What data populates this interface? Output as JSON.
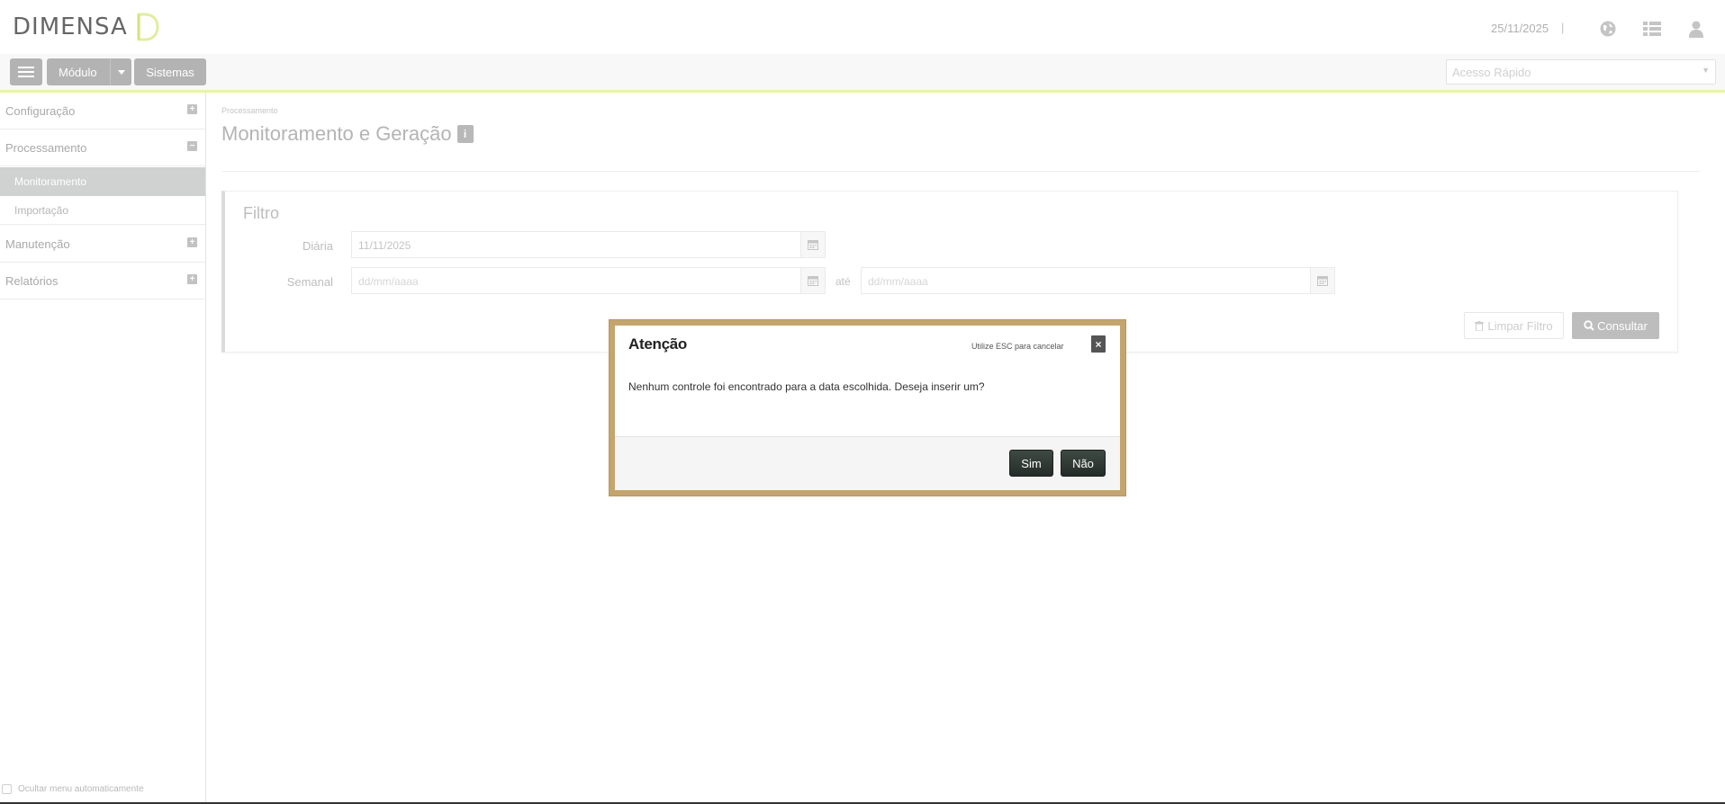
{
  "header": {
    "logo_text": "DIMENSA",
    "date": "25/11/2025",
    "separator": "|"
  },
  "toolbar": {
    "modulo_label": "Módulo",
    "sistemas_label": "Sistemas",
    "quick_access_placeholder": "Acesso Rápido"
  },
  "sidebar": {
    "items": [
      {
        "label": "Configuração",
        "toggle": "+"
      },
      {
        "label": "Processamento",
        "toggle": "−"
      },
      {
        "label": "Manutenção",
        "toggle": "+"
      },
      {
        "label": "Relatórios",
        "toggle": "+"
      }
    ],
    "subitems": [
      {
        "label": "Monitoramento"
      },
      {
        "label": "Importação"
      }
    ],
    "footer_label": "Ocultar menu automaticamente"
  },
  "main": {
    "breadcrumb": "Processamento",
    "title": "Monitoramento e Geração",
    "info_badge": "i",
    "filter": {
      "title": "Filtro",
      "diaria_label": "Diária",
      "diaria_value": "11/11/2025",
      "semanal_label": "Semanal",
      "semanal_start_placeholder": "dd/mm/aaaa",
      "ate_label": "até",
      "semanal_end_placeholder": "dd/mm/aaaa",
      "limpar_label": "Limpar Filtro",
      "consultar_label": "Consultar"
    }
  },
  "modal": {
    "title": "Atenção",
    "hint": "Utilize ESC para cancelar",
    "close": "×",
    "message": "Nenhum controle foi encontrado para a data escolhida. Deseja inserir um?",
    "yes_label": "Sim",
    "no_label": "Não"
  },
  "colors": {
    "accent_line": "#e8f2b0",
    "modal_frame": "#c4a56d",
    "modal_button": "#2f3833",
    "sidebar_active": "#d0d1d1"
  }
}
